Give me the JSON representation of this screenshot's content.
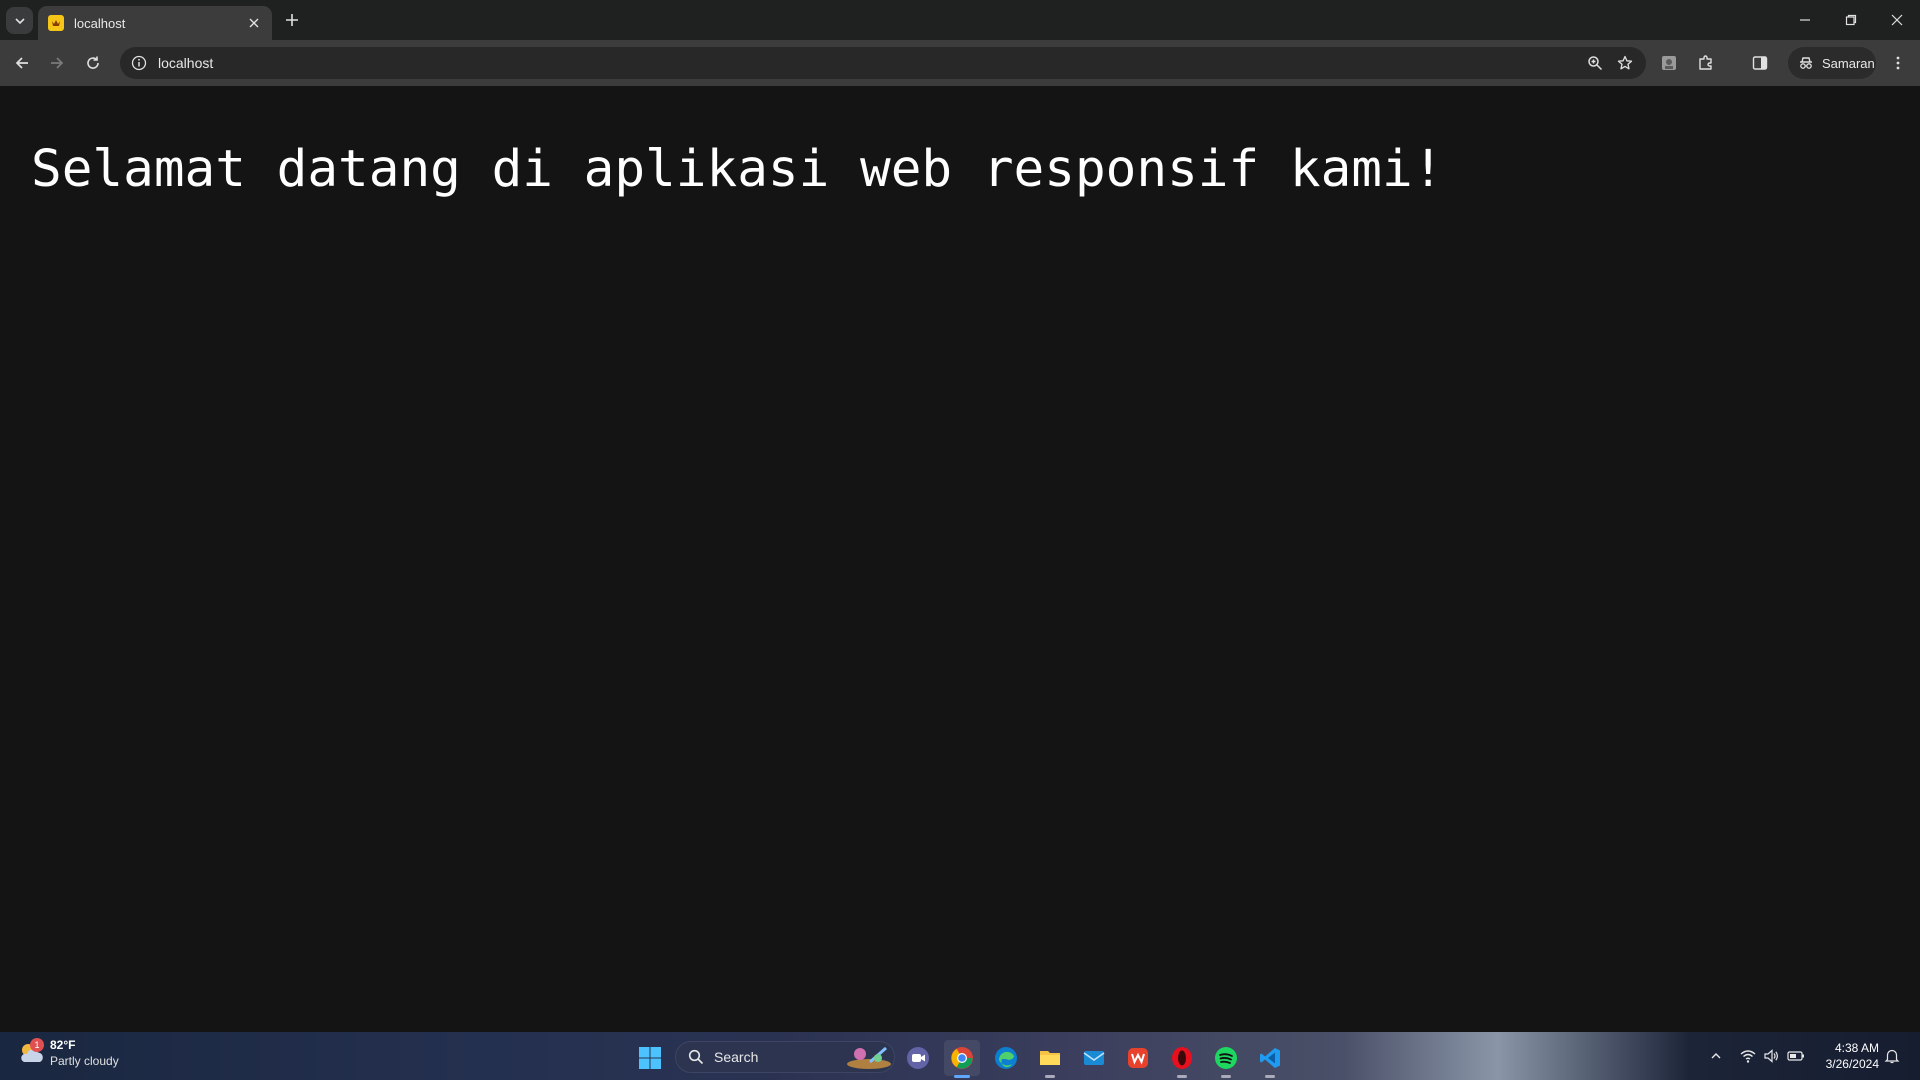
{
  "browser": {
    "tab": {
      "title": "localhost"
    },
    "address_bar": {
      "url": "localhost"
    },
    "profile": {
      "name": "Samaran"
    }
  },
  "page": {
    "heading": "Selamat datang di aplikasi web responsif kami!"
  },
  "taskbar": {
    "weather": {
      "temp": "82°F",
      "condition": "Partly cloudy",
      "badge": "1"
    },
    "search": {
      "label": "Search"
    },
    "apps": [
      "windows-start",
      "zoom",
      "chrome",
      "edge",
      "file-explorer",
      "mail",
      "wps-office",
      "opera",
      "spotify",
      "vscode"
    ],
    "clock": {
      "time": "4:38 AM",
      "date": "3/26/2024"
    }
  },
  "colors": {
    "page_bg": "#141414",
    "toolbar_bg": "#3c3c3c",
    "tabstrip_bg": "#1f2020",
    "accent": "#60a8ff"
  }
}
